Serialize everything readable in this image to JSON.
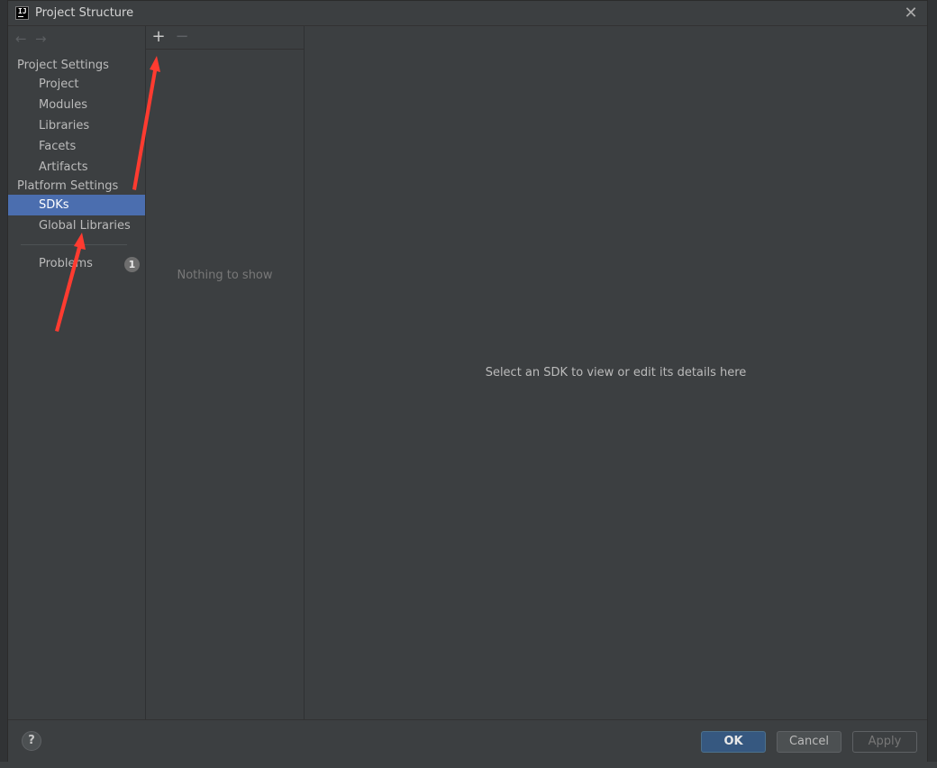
{
  "window": {
    "title": "Project Structure"
  },
  "sidebar": {
    "project_settings_title": "Project Settings",
    "project_items": [
      "Project",
      "Modules",
      "Libraries",
      "Facets",
      "Artifacts"
    ],
    "platform_settings_title": "Platform Settings",
    "platform_items": [
      "SDKs",
      "Global Libraries"
    ],
    "selected": "SDKs",
    "problems_label": "Problems",
    "problems_count": "1"
  },
  "list_panel": {
    "empty_text": "Nothing to show"
  },
  "details": {
    "placeholder": "Select an SDK to view or edit its details here"
  },
  "footer": {
    "help_label": "?",
    "ok_label": "OK",
    "cancel_label": "Cancel",
    "apply_label": "Apply"
  },
  "colors": {
    "background": "#3c3f41",
    "selection": "#4b6eaf",
    "ok_button": "#365880",
    "annotation_arrow": "#ff3b30"
  }
}
